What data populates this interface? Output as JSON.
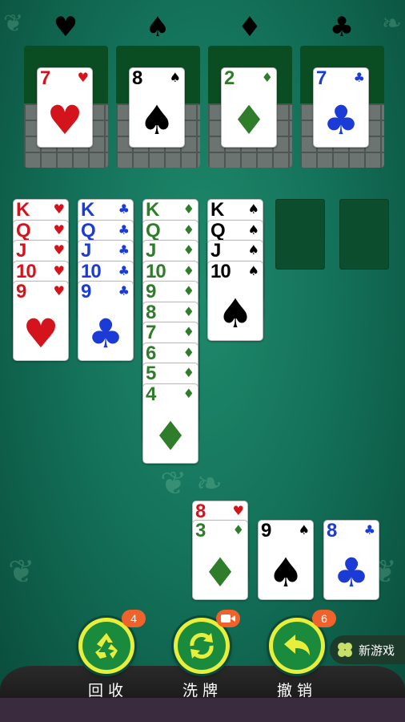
{
  "foundation_suits": [
    "♥",
    "♠",
    "♦",
    "♣"
  ],
  "foundations": [
    {
      "rank": "7",
      "suit": "♥",
      "color": "red"
    },
    {
      "rank": "8",
      "suit": "♠",
      "color": "black"
    },
    {
      "rank": "2",
      "suit": "♦",
      "color": "green"
    },
    {
      "rank": "7",
      "suit": "♣",
      "color": "blue"
    }
  ],
  "tableau": [
    [
      {
        "rank": "K",
        "suit": "♥",
        "color": "red"
      },
      {
        "rank": "Q",
        "suit": "♥",
        "color": "red"
      },
      {
        "rank": "J",
        "suit": "♥",
        "color": "red"
      },
      {
        "rank": "10",
        "suit": "♥",
        "color": "red"
      },
      {
        "rank": "9",
        "suit": "♥",
        "color": "red"
      }
    ],
    [
      {
        "rank": "K",
        "suit": "♣",
        "color": "blue"
      },
      {
        "rank": "Q",
        "suit": "♣",
        "color": "blue"
      },
      {
        "rank": "J",
        "suit": "♣",
        "color": "blue"
      },
      {
        "rank": "10",
        "suit": "♣",
        "color": "blue"
      },
      {
        "rank": "9",
        "suit": "♣",
        "color": "blue"
      }
    ],
    [
      {
        "rank": "K",
        "suit": "♦",
        "color": "green"
      },
      {
        "rank": "Q",
        "suit": "♦",
        "color": "green"
      },
      {
        "rank": "J",
        "suit": "♦",
        "color": "green"
      },
      {
        "rank": "10",
        "suit": "♦",
        "color": "green"
      },
      {
        "rank": "9",
        "suit": "♦",
        "color": "green"
      },
      {
        "rank": "8",
        "suit": "♦",
        "color": "green"
      },
      {
        "rank": "7",
        "suit": "♦",
        "color": "green"
      },
      {
        "rank": "6",
        "suit": "♦",
        "color": "green"
      },
      {
        "rank": "5",
        "suit": "♦",
        "color": "green"
      },
      {
        "rank": "4",
        "suit": "♦",
        "color": "green"
      }
    ],
    [
      {
        "rank": "K",
        "suit": "♠",
        "color": "black"
      },
      {
        "rank": "Q",
        "suit": "♠",
        "color": "black"
      },
      {
        "rank": "J",
        "suit": "♠",
        "color": "black"
      },
      {
        "rank": "10",
        "suit": "♠",
        "color": "black"
      }
    ]
  ],
  "stock": [
    {
      "rank": "8",
      "suit": "♥",
      "color": "red"
    },
    {
      "rank": "3",
      "suit": "♦",
      "color": "green"
    }
  ],
  "waste": [
    {
      "rank": "9",
      "suit": "♠",
      "color": "black"
    },
    {
      "rank": "8",
      "suit": "♣",
      "color": "blue"
    }
  ],
  "buttons": {
    "recycle": {
      "label": "回收",
      "badge": "4",
      "icon": "recycle-icon"
    },
    "shuffle": {
      "label": "洗牌",
      "icon": "shuffle-icon",
      "badge_icon": "video-icon"
    },
    "undo": {
      "label": "撤销",
      "badge": "6",
      "icon": "undo-arrow-icon"
    },
    "new_game": {
      "label": "新游戏",
      "icon": "clover-icon"
    }
  },
  "colors": {
    "red": "#d4141c",
    "black": "#000000",
    "blue": "#1b3bd6",
    "green": "#2f7d2a",
    "button": "#e8ef3b",
    "badge": "#f0622b"
  }
}
